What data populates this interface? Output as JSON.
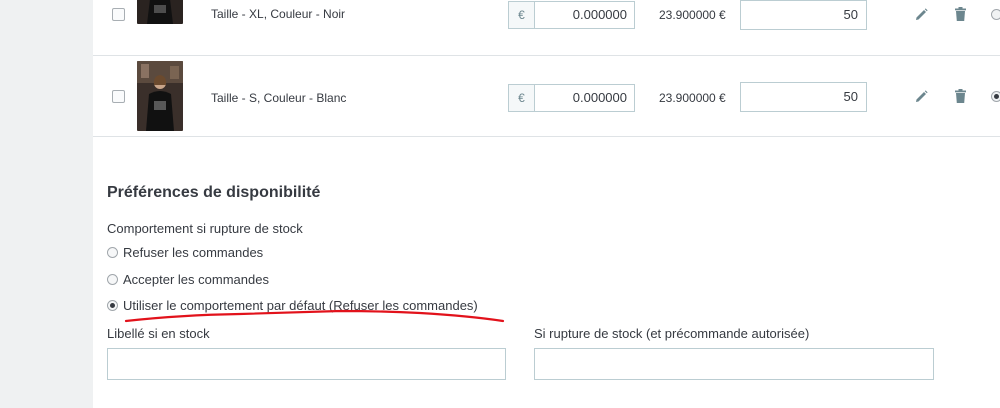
{
  "combinations": [
    {
      "label": "Taille - XL, Couleur - Noir",
      "currency": "€",
      "impact_price": "0.000000",
      "final_price": "23.900000 €",
      "quantity": "50"
    },
    {
      "label": "Taille - S, Couleur - Blanc",
      "currency": "€",
      "impact_price": "0.000000",
      "final_price": "23.900000 €",
      "quantity": "50"
    }
  ],
  "availability": {
    "title": "Préférences de disponibilité",
    "behavior_label": "Comportement si rupture de stock",
    "options": [
      {
        "label": "Refuser les commandes",
        "checked": false
      },
      {
        "label": "Accepter les commandes",
        "checked": false
      },
      {
        "label": "Utiliser le comportement par défaut (Refuser les commandes)",
        "checked": true
      }
    ],
    "in_stock_label": "Libellé si en stock",
    "out_of_stock_label": "Si rupture de stock (et précommande autorisée)",
    "in_stock_value": "",
    "out_of_stock_value": ""
  },
  "icons": {
    "edit": "pencil-icon",
    "delete": "trash-icon"
  },
  "annotation_color": "#e2121b"
}
